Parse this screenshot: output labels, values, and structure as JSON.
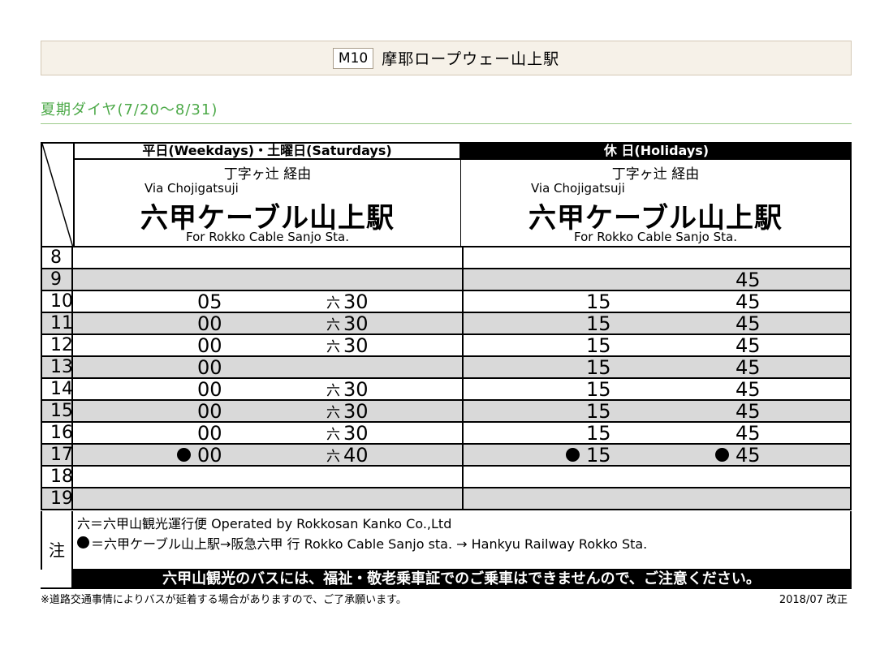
{
  "header": {
    "code": "M10",
    "station": "摩耶ロープウェー山上駅"
  },
  "season": "夏期ダイヤ(7/20～8/31)",
  "columns": {
    "left": {
      "label": "平日(Weekdays)・土曜日(Saturdays)",
      "via_jp": "丁字ヶ辻 経由",
      "via_en": "Via Chojigatsuji",
      "dest_jp": "六甲ケーブル山上駅",
      "dest_en": "For Rokko Cable Sanjo Sta."
    },
    "right": {
      "label": "休 日(Holidays)",
      "via_jp": "丁字ヶ辻 経由",
      "via_en": "Via Chojigatsuji",
      "dest_jp": "六甲ケーブル山上駅",
      "dest_en": "For Rokko Cable Sanjo Sta."
    }
  },
  "roku_mark": "六",
  "rows": [
    {
      "hour": "8",
      "shade": false,
      "wk1": "",
      "wk1_dot": false,
      "wk2": "",
      "wk2_roku": false,
      "hd1": "",
      "hd1_dot": false,
      "hd2": "",
      "hd2_dot": false
    },
    {
      "hour": "9",
      "shade": true,
      "wk1": "",
      "wk1_dot": false,
      "wk2": "",
      "wk2_roku": false,
      "hd1": "",
      "hd1_dot": false,
      "hd2": "45",
      "hd2_dot": false
    },
    {
      "hour": "10",
      "shade": false,
      "wk1": "05",
      "wk1_dot": false,
      "wk2": "30",
      "wk2_roku": true,
      "hd1": "15",
      "hd1_dot": false,
      "hd2": "45",
      "hd2_dot": false
    },
    {
      "hour": "11",
      "shade": true,
      "wk1": "00",
      "wk1_dot": false,
      "wk2": "30",
      "wk2_roku": true,
      "hd1": "15",
      "hd1_dot": false,
      "hd2": "45",
      "hd2_dot": false
    },
    {
      "hour": "12",
      "shade": false,
      "wk1": "00",
      "wk1_dot": false,
      "wk2": "30",
      "wk2_roku": true,
      "hd1": "15",
      "hd1_dot": false,
      "hd2": "45",
      "hd2_dot": false
    },
    {
      "hour": "13",
      "shade": true,
      "wk1": "00",
      "wk1_dot": false,
      "wk2": "",
      "wk2_roku": false,
      "hd1": "15",
      "hd1_dot": false,
      "hd2": "45",
      "hd2_dot": false
    },
    {
      "hour": "14",
      "shade": false,
      "wk1": "00",
      "wk1_dot": false,
      "wk2": "30",
      "wk2_roku": true,
      "hd1": "15",
      "hd1_dot": false,
      "hd2": "45",
      "hd2_dot": false
    },
    {
      "hour": "15",
      "shade": true,
      "wk1": "00",
      "wk1_dot": false,
      "wk2": "30",
      "wk2_roku": true,
      "hd1": "15",
      "hd1_dot": false,
      "hd2": "45",
      "hd2_dot": false
    },
    {
      "hour": "16",
      "shade": false,
      "wk1": "00",
      "wk1_dot": false,
      "wk2": "30",
      "wk2_roku": true,
      "hd1": "15",
      "hd1_dot": false,
      "hd2": "45",
      "hd2_dot": false
    },
    {
      "hour": "17",
      "shade": true,
      "wk1": "00",
      "wk1_dot": true,
      "wk2": "40",
      "wk2_roku": true,
      "hd1": "15",
      "hd1_dot": true,
      "hd2": "45",
      "hd2_dot": true
    },
    {
      "hour": "18",
      "shade": false,
      "wk1": "",
      "wk1_dot": false,
      "wk2": "",
      "wk2_roku": false,
      "hd1": "",
      "hd1_dot": false,
      "hd2": "",
      "hd2_dot": false
    },
    {
      "hour": "19",
      "shade": true,
      "wk1": "",
      "wk1_dot": false,
      "wk2": "",
      "wk2_roku": false,
      "hd1": "",
      "hd1_dot": false,
      "hd2": "",
      "hd2_dot": false
    }
  ],
  "notes": {
    "label": "注",
    "line1": "六＝六甲山観光運行便  Operated by Rokkosan Kanko Co.,Ltd",
    "line2": "＝六甲ケーブル山上駅→阪急六甲  行  Rokko Cable Sanjo sta. → Hankyu Railway Rokko Sta."
  },
  "warning": "六甲山観光のバスには、福祉・敬老乗車証でのご乗車はできませんので、ご注意ください。",
  "footnote": "※道路交通事情によりバスが延着する場合がありますので、ご了承願います。",
  "revision": "2018/07  改正"
}
